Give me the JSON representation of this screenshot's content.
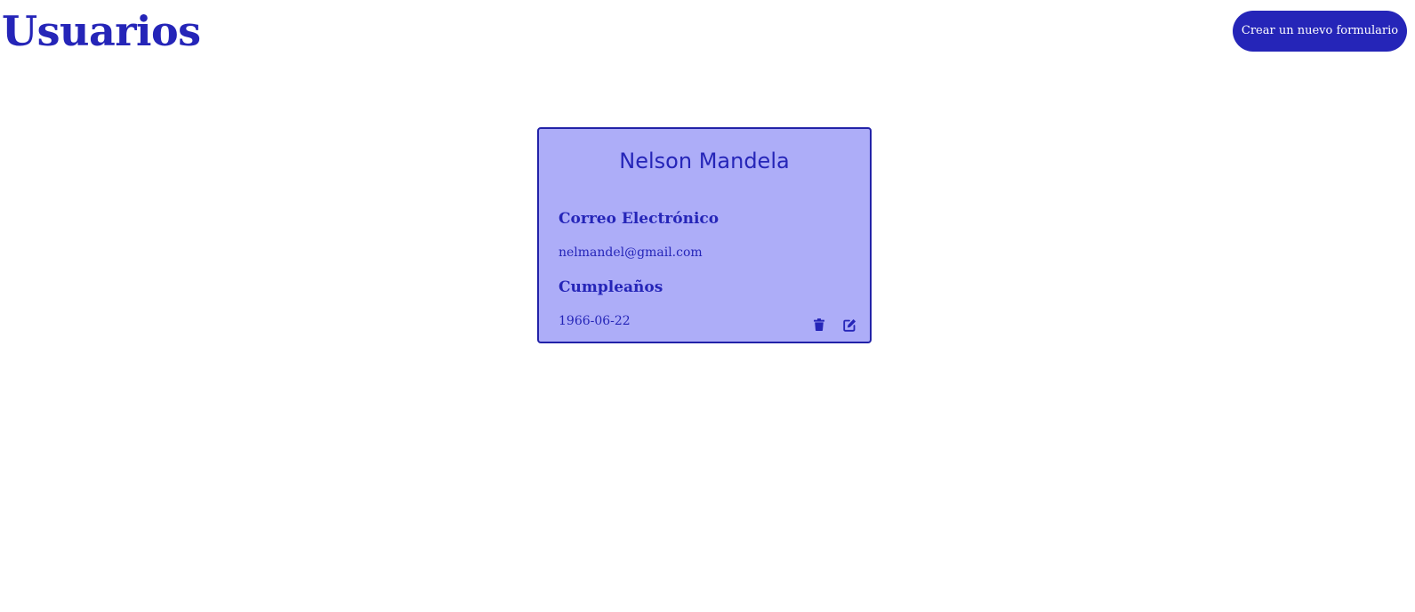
{
  "page": {
    "title": "Usuarios"
  },
  "toolbar": {
    "create_label": "Crear un nuevo formulario"
  },
  "users": [
    {
      "name": "Nelson Mandela",
      "email_label": "Correo Electrónico",
      "email": "nelmandel@gmail.com",
      "birthday_label": "Cumpleaños",
      "birthday": "1966-06-22",
      "actions": [
        {
          "icon": "trash-icon"
        },
        {
          "icon": "edit-icon"
        }
      ]
    }
  ],
  "colors": {
    "accent": "#2525b8",
    "card_background": "#adadf8",
    "card_border": "#2222a8",
    "page_background": "#ffffff",
    "button_text": "#ffffff"
  }
}
